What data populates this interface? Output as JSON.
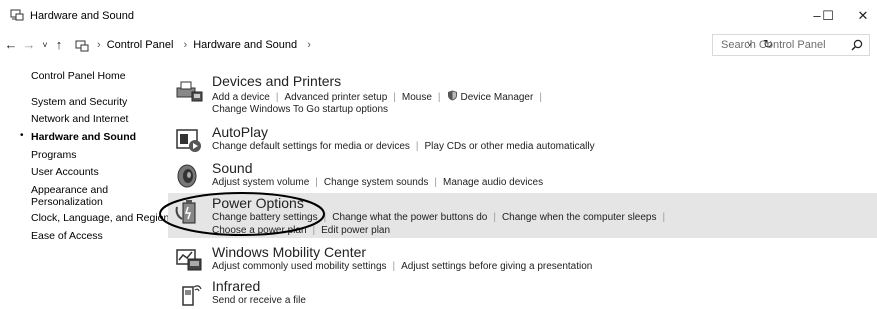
{
  "window": {
    "title": "Hardware and Sound",
    "minimize_label": "–",
    "maximize_label": "☐",
    "close_label": "✕"
  },
  "navigation": {
    "back": "←",
    "forward": "→",
    "recent": "˅",
    "up": "↑",
    "breadcrumbs": [
      "Control Panel",
      "Hardware and Sound"
    ],
    "crumb_separator": "›",
    "dropdown": "˅",
    "refresh": "↻"
  },
  "search": {
    "placeholder": "Search Control Panel"
  },
  "sidebar": {
    "items": [
      {
        "label": "Control Panel Home"
      },
      {
        "label": "System and Security"
      },
      {
        "label": "Network and Internet"
      },
      {
        "label": "Hardware and Sound",
        "active": true
      },
      {
        "label": "Programs"
      },
      {
        "label": "User Accounts"
      },
      {
        "label": "Appearance and"
      },
      {
        "label": "Personalization"
      },
      {
        "label": "Clock, Language, and Region"
      },
      {
        "label": "Ease of Access"
      }
    ],
    "bullet": "•"
  },
  "categories": [
    {
      "heading": "Devices and Printers",
      "links_row1": [
        "Add a device",
        "Advanced printer setup",
        "Mouse",
        "Device Manager"
      ],
      "links_row2": [
        "Change Windows To Go startup options"
      ],
      "icon": "printer-icon"
    },
    {
      "heading": "AutoPlay",
      "links_row1": [
        "Change default settings for media or devices",
        "Play CDs or other media automatically"
      ],
      "icon": "autoplay-icon"
    },
    {
      "heading": "Sound",
      "links_row1": [
        "Adjust system volume",
        "Change system sounds",
        "Manage audio devices"
      ],
      "icon": "speaker-icon"
    },
    {
      "heading": "Power Options",
      "links_row1": [
        "Change battery settings",
        "Change what the power buttons do",
        "Change when the computer sleeps"
      ],
      "links_row2": [
        "Choose a power plan",
        "Edit power plan"
      ],
      "icon": "power-options-icon",
      "highlighted": true
    },
    {
      "heading": "Windows Mobility Center",
      "links_row1": [
        "Adjust commonly used mobility settings",
        "Adjust settings before giving a presentation"
      ],
      "icon": "mobility-center-icon"
    },
    {
      "heading": "Infrared",
      "links_row1": [
        "Send or receive a file"
      ],
      "icon": "infrared-icon"
    }
  ],
  "colors": {
    "highlight_row": "#e5e5e5",
    "link_separator": "#9a9a9a",
    "annotation_ellipse": "#000000"
  }
}
